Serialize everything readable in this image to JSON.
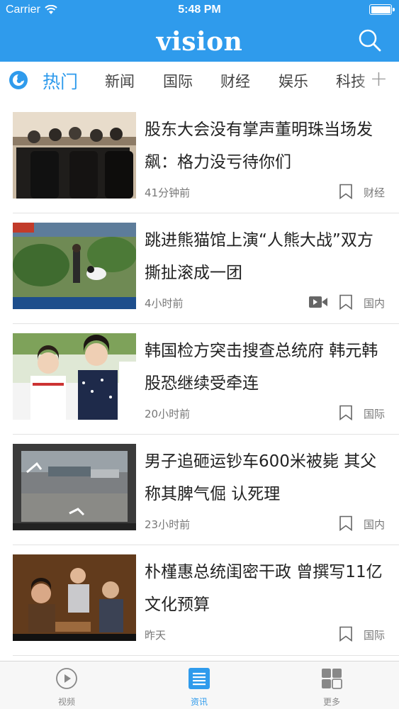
{
  "status_bar": {
    "carrier": "Carrier",
    "time": "5:48 PM"
  },
  "header": {
    "logo": "vision"
  },
  "tabs": {
    "items": [
      {
        "label": "热门",
        "active": true
      },
      {
        "label": "新闻"
      },
      {
        "label": "国际"
      },
      {
        "label": "财经"
      },
      {
        "label": "娱乐"
      },
      {
        "label": "科技"
      }
    ],
    "add_label": "+"
  },
  "feed": {
    "items": [
      {
        "title": "股东大会没有掌声董明珠当场发飙：格力没亏待你们",
        "time": "41分钟前",
        "tag": "财经",
        "has_video": false
      },
      {
        "title": "跳进熊猫馆上演“人熊大战”双方撕扯滚成一团",
        "time": "4小时前",
        "tag": "国内",
        "has_video": true
      },
      {
        "title": "韩国检方突击搜查总统府 韩元韩股恐继续受牵连",
        "time": "20小时前",
        "tag": "国际",
        "has_video": false
      },
      {
        "title": "男子追砸运钞车600米被毙 其父称其脾气倔 认死理",
        "time": "23小时前",
        "tag": "国内",
        "has_video": false
      },
      {
        "title": "朴槿惠总统闺密干政 曾撰写11亿文化预算",
        "time": "昨天",
        "tag": "国际",
        "has_video": false
      }
    ]
  },
  "bottom_nav": {
    "items": [
      {
        "label": "视频",
        "icon": "play-circle-icon"
      },
      {
        "label": "资讯",
        "icon": "news-list-icon",
        "active": true
      },
      {
        "label": "更多",
        "icon": "grid-icon"
      }
    ]
  },
  "colors": {
    "brand": "#2f9bec",
    "text": "#222222",
    "meta": "#777777"
  }
}
